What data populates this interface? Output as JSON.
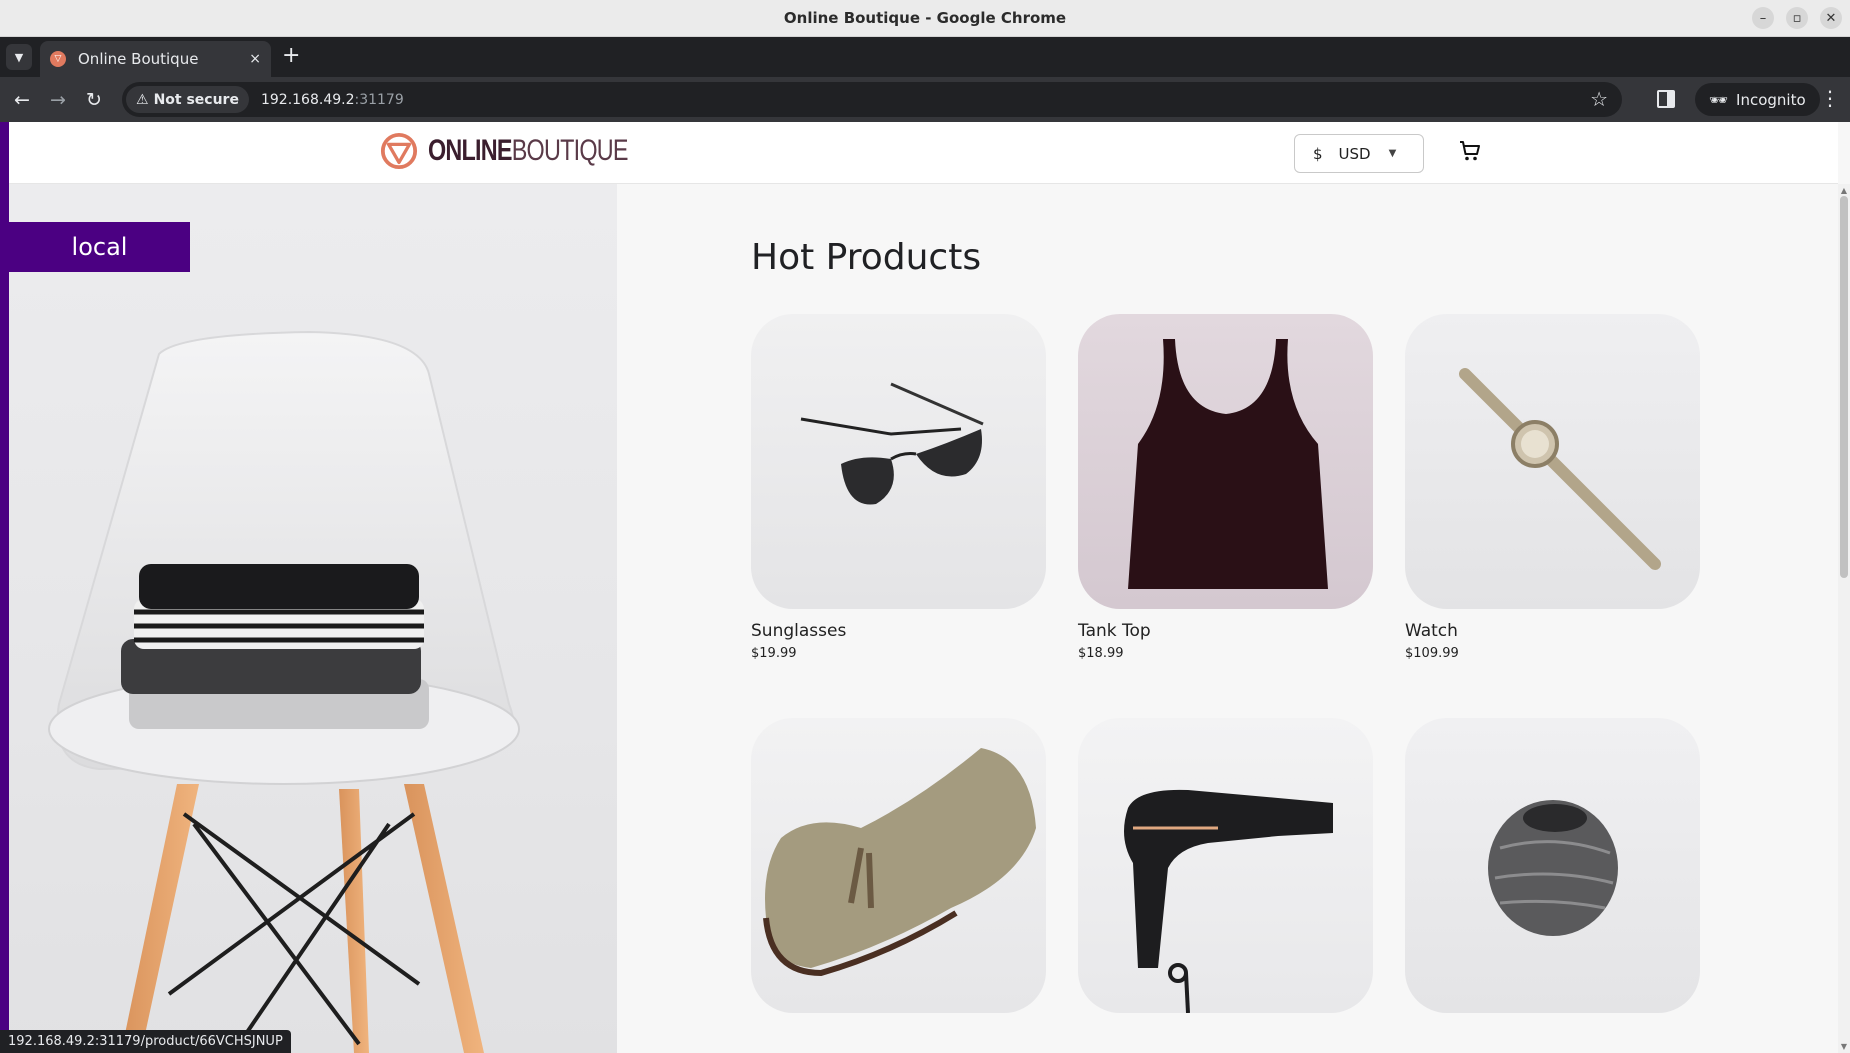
{
  "window": {
    "title": "Online Boutique - Google Chrome",
    "controls": [
      "–",
      "▫",
      "✕"
    ]
  },
  "tab": {
    "title": "Online Boutique",
    "close": "×",
    "new_tab": "+"
  },
  "toolbar": {
    "back": "←",
    "forward": "→",
    "reload": "↻",
    "security_label": "Not secure",
    "url_host": "192.168.49.2",
    "url_port": ":31179",
    "bookmark": "☆",
    "incognito_label": "Incognito",
    "menu": "⋮"
  },
  "header": {
    "logo_bold": "ONLINE",
    "logo_light": "BOUTIQUE",
    "currency_symbol": "$",
    "currency_code": "USD"
  },
  "hero": {
    "env_badge": "local"
  },
  "main": {
    "section_title": "Hot Products",
    "products": [
      {
        "name": "Sunglasses",
        "price": "$19.99"
      },
      {
        "name": "Tank Top",
        "price": "$18.99"
      },
      {
        "name": "Watch",
        "price": "$109.99"
      },
      {
        "name": "",
        "price": ""
      },
      {
        "name": "",
        "price": ""
      },
      {
        "name": "",
        "price": ""
      }
    ]
  },
  "status_bar": {
    "link_url": "192.168.49.2:31179/product/66VCHSJNUP"
  },
  "colors": {
    "accent": "#4b0082",
    "logo": "#e07a5f",
    "text": "#202124"
  }
}
